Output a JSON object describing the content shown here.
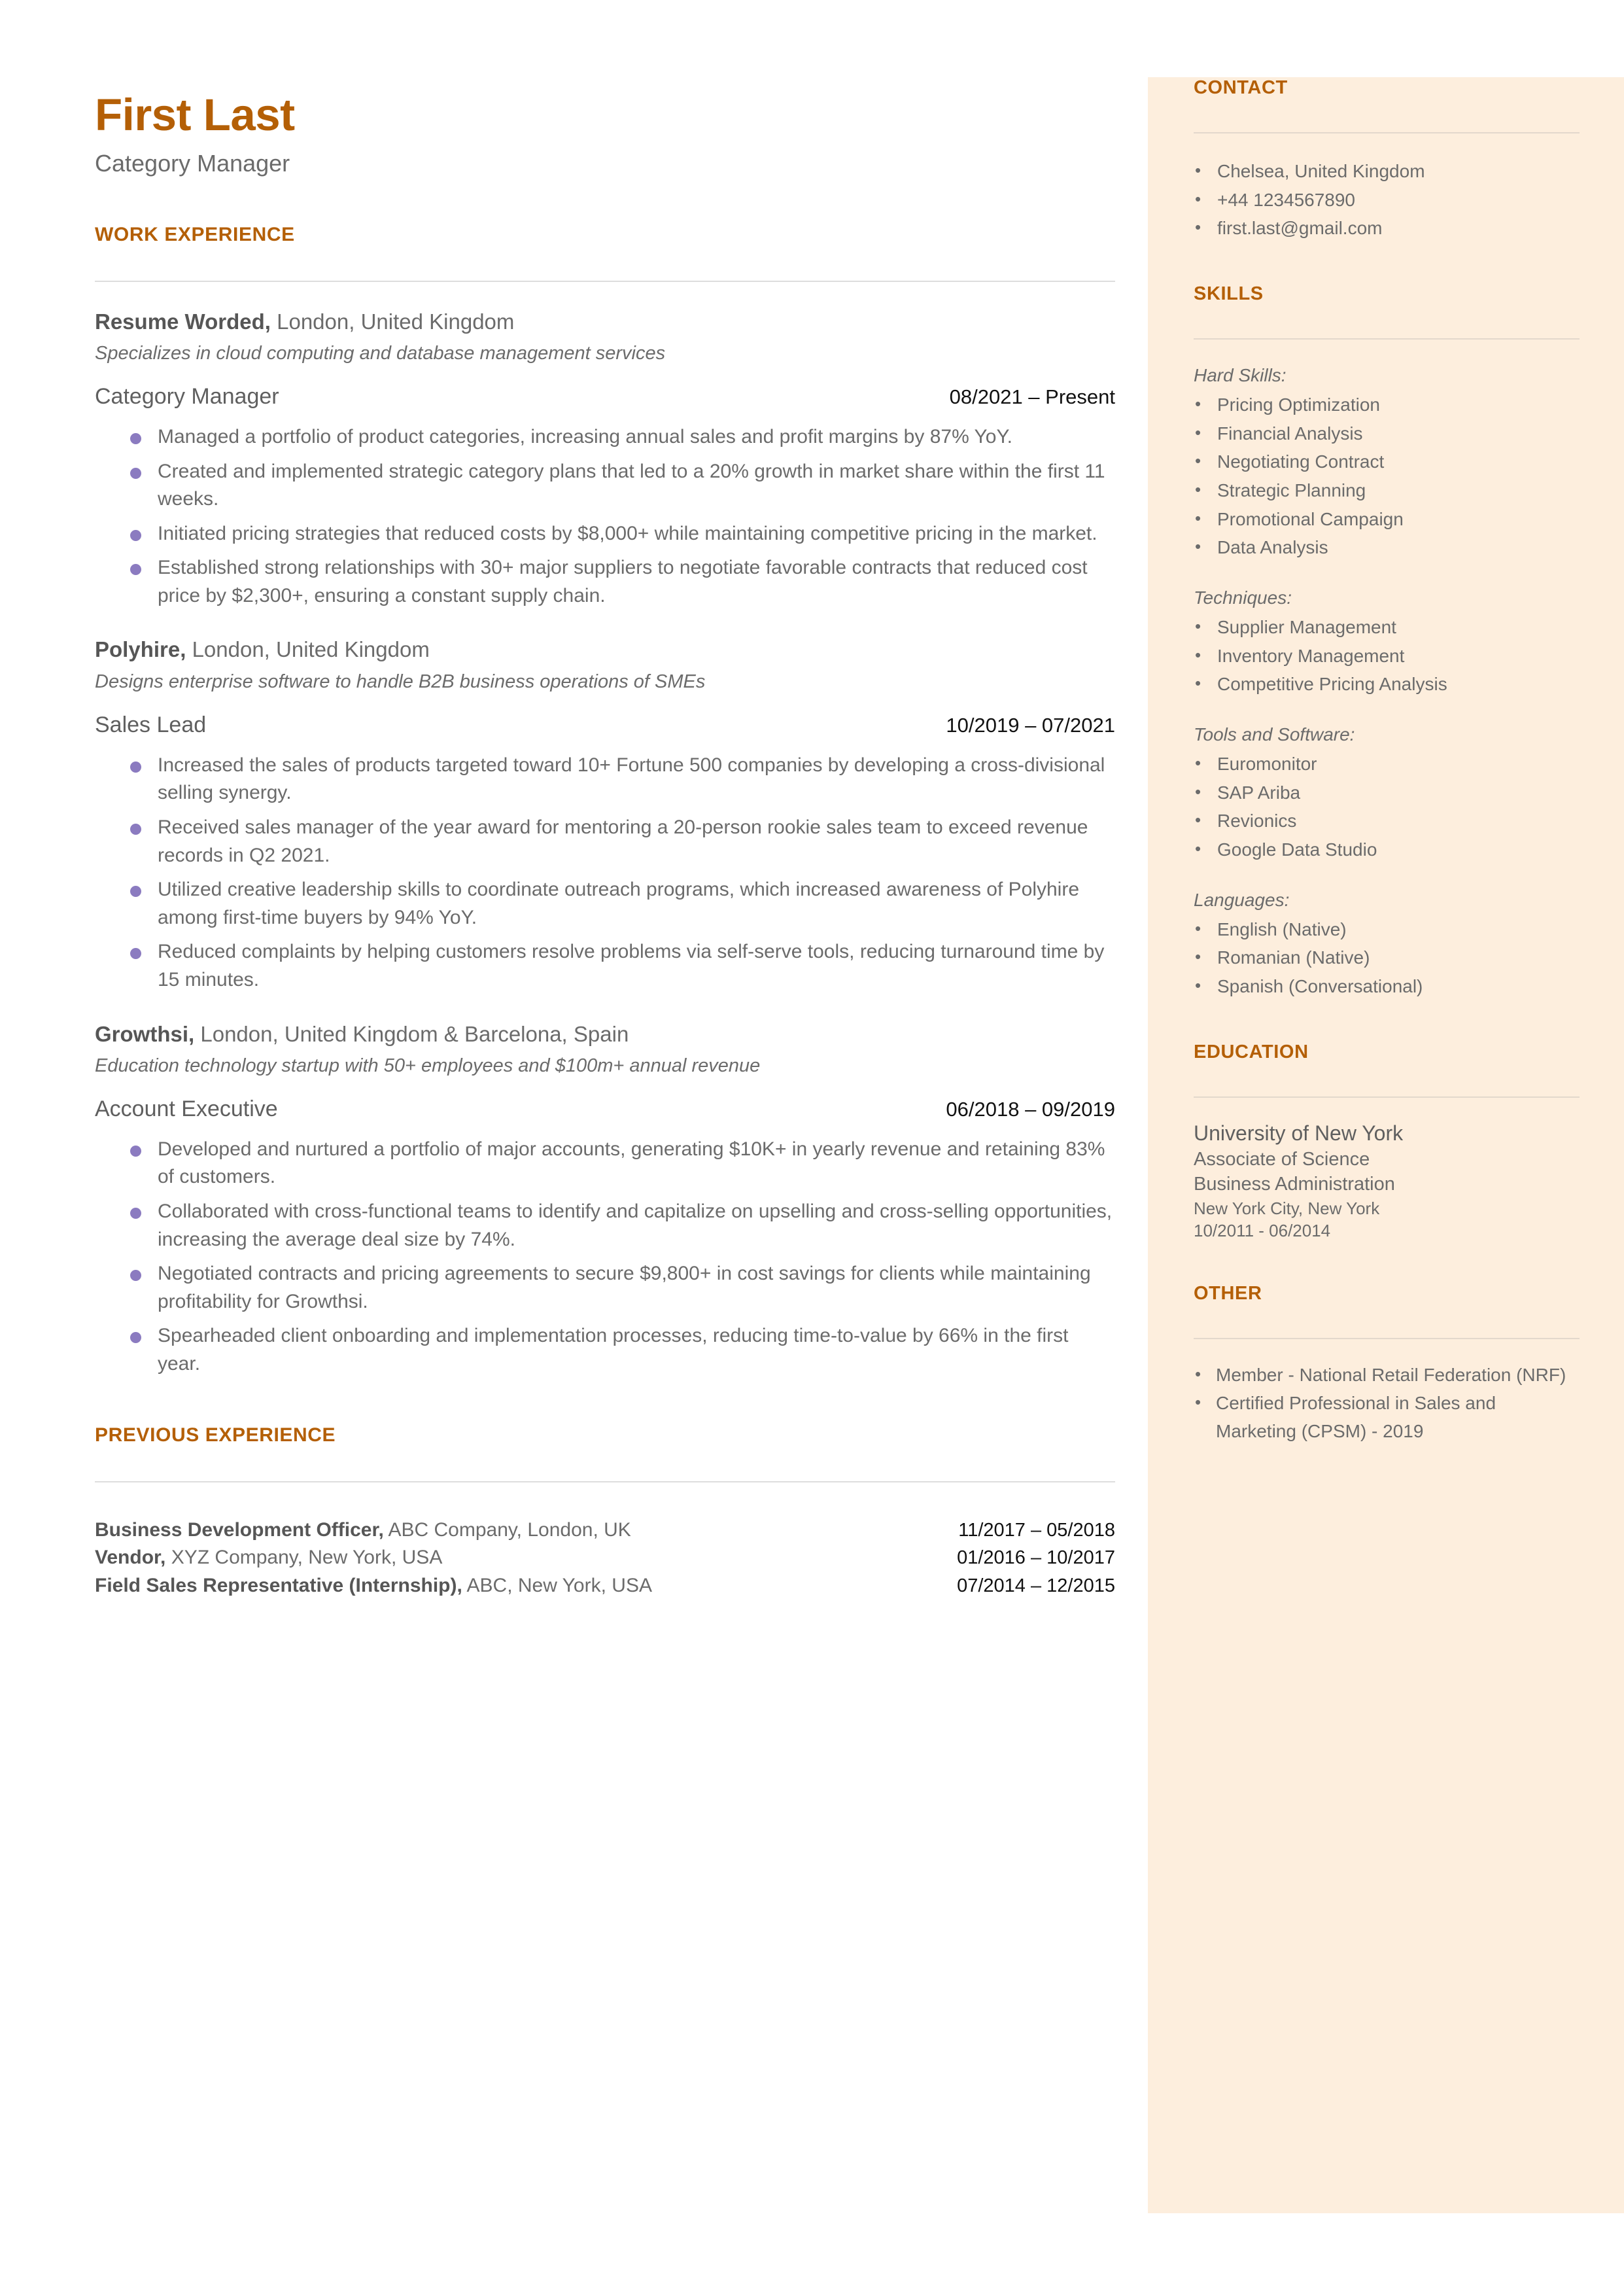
{
  "theme": {
    "accent": "#b45f06",
    "sidebar_bg": "#fdeedd",
    "bullet": "#8b7bc0",
    "body_text": "#6b6b6b"
  },
  "header": {
    "name": "First Last",
    "job_title": "Category Manager"
  },
  "work_experience": {
    "section_label": "WORK EXPERIENCE",
    "entries": [
      {
        "company": "Resume Worded,",
        "location": "London, United Kingdom",
        "description": "Specializes in cloud computing and database management services",
        "role": "Category Manager",
        "dates": "08/2021 – Present",
        "bullets": [
          "Managed a portfolio of product categories, increasing annual sales and profit margins by 87% YoY.",
          "Created and implemented strategic category plans that led to a 20% growth in market share within the first 11 weeks.",
          "Initiated pricing strategies that reduced costs by $8,000+ while maintaining competitive pricing in the market.",
          "Established strong relationships with 30+ major suppliers to negotiate favorable contracts that reduced cost price by $2,300+, ensuring a constant supply chain."
        ]
      },
      {
        "company": "Polyhire,",
        "location": "London, United Kingdom",
        "description": "Designs enterprise software to handle B2B business operations of SMEs",
        "role": "Sales Lead",
        "dates": "10/2019 – 07/2021",
        "bullets": [
          "Increased the sales of products targeted toward 10+ Fortune 500 companies by developing a cross-divisional selling synergy.",
          "Received sales manager of the year award for mentoring a 20-person rookie sales team to exceed revenue records in Q2 2021.",
          "Utilized creative leadership skills to coordinate outreach programs, which increased awareness of Polyhire among first-time buyers by 94% YoY.",
          "Reduced complaints by helping customers resolve problems via self-serve tools, reducing turnaround time by 15 minutes."
        ]
      },
      {
        "company": "Growthsi,",
        "location": "London, United Kingdom & Barcelona, Spain",
        "description": "Education technology startup with 50+ employees and $100m+ annual revenue",
        "role": "Account Executive",
        "dates": "06/2018 – 09/2019",
        "bullets": [
          "Developed and nurtured a portfolio of major accounts, generating $10K+ in yearly revenue and retaining 83% of customers.",
          "Collaborated with cross-functional teams to identify and capitalize on upselling and cross-selling opportunities,  increasing the average deal size by 74%.",
          "Negotiated contracts and pricing agreements to secure $9,800+ in cost savings for clients while maintaining profitability for Growthsi.",
          "Spearheaded client onboarding and implementation processes, reducing time-to-value by 66% in the first year."
        ]
      }
    ]
  },
  "previous_experience": {
    "section_label": "PREVIOUS EXPERIENCE",
    "rows": [
      {
        "role": "Business Development Officer,",
        "detail": "ABC Company, London, UK",
        "dates": "11/2017 – 05/2018"
      },
      {
        "role": "Vendor,",
        "detail": "XYZ Company, New York, USA",
        "dates": "01/2016 – 10/2017"
      },
      {
        "role": "Field Sales Representative (Internship),",
        "detail": "ABC, New York, USA",
        "dates": "07/2014 – 12/2015"
      }
    ]
  },
  "sidebar": {
    "contact": {
      "label": "CONTACT",
      "items": [
        "Chelsea, United Kingdom",
        "+44 1234567890",
        "first.last@gmail.com"
      ]
    },
    "skills": {
      "label": "SKILLS",
      "groups": [
        {
          "label": "Hard Skills:",
          "items": [
            "Pricing Optimization",
            "Financial Analysis",
            "Negotiating Contract",
            "Strategic Planning",
            "Promotional Campaign",
            "Data Analysis"
          ]
        },
        {
          "label": "Techniques:",
          "items": [
            "Supplier Management",
            "Inventory Management",
            "Competitive Pricing Analysis"
          ]
        },
        {
          "label": "Tools and Software:",
          "items": [
            "Euromonitor",
            "SAP Ariba",
            "Revionics",
            "Google Data Studio"
          ]
        },
        {
          "label": "Languages:",
          "items": [
            "English (Native)",
            "Romanian (Native)",
            "Spanish (Conversational)"
          ]
        }
      ]
    },
    "education": {
      "label": "EDUCATION",
      "school": "University of New York",
      "degree": "Associate of Science",
      "field": "Business Administration",
      "location": "New York City, New York",
      "dates": "10/2011 - 06/2014"
    },
    "other": {
      "label": "OTHER",
      "items": [
        "Member -  National Retail Federation (NRF)",
        "Certified Professional in Sales and Marketing (CPSM) - 2019"
      ]
    }
  }
}
